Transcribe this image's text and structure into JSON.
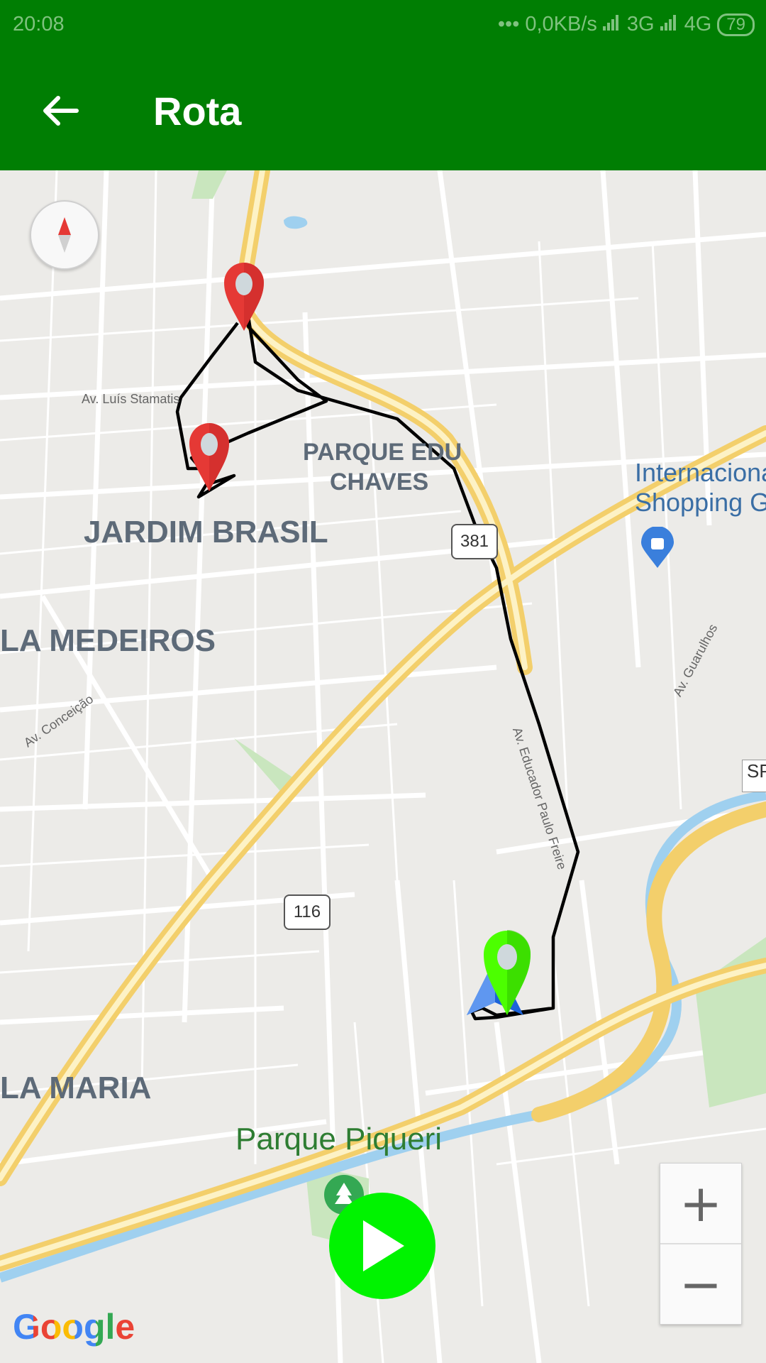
{
  "status_bar": {
    "time": "20:08",
    "dots": "•••",
    "speed": "0,0KB/s",
    "net1": "3G",
    "net2": "4G",
    "battery": "79"
  },
  "app_bar": {
    "back_icon": "arrow-left-icon",
    "title": "Rota"
  },
  "map": {
    "area_labels": [
      "JARDIM BRASIL",
      "LA MEDEIROS",
      "LA MARIA"
    ],
    "neighborhood": [
      "PARQUE EDU",
      "CHAVES"
    ],
    "park_label": "Parque Piqueri",
    "poi_label": [
      "Internaciona",
      "Shopping Gu"
    ],
    "street_labels": {
      "luis": "Av. Luís Stamatis",
      "conceicao": "Av. Conceição",
      "educador": "Av. Educador Paulo Freire",
      "guarulhos": "Av. Guarulhos"
    },
    "highway_381": "381",
    "highway_116": "116",
    "sp_badge": "SP",
    "google_logo": "Google",
    "colors": {
      "route": "#000000",
      "marker_red": "#e53935",
      "marker_green": "#4cff00",
      "highway": "#f6d46b",
      "water": "#9fd0ef",
      "park": "#c9e6be"
    }
  },
  "controls": {
    "zoom_in": "+",
    "zoom_out": "−",
    "compass_icon": "compass-icon",
    "play_icon": "play-icon"
  }
}
